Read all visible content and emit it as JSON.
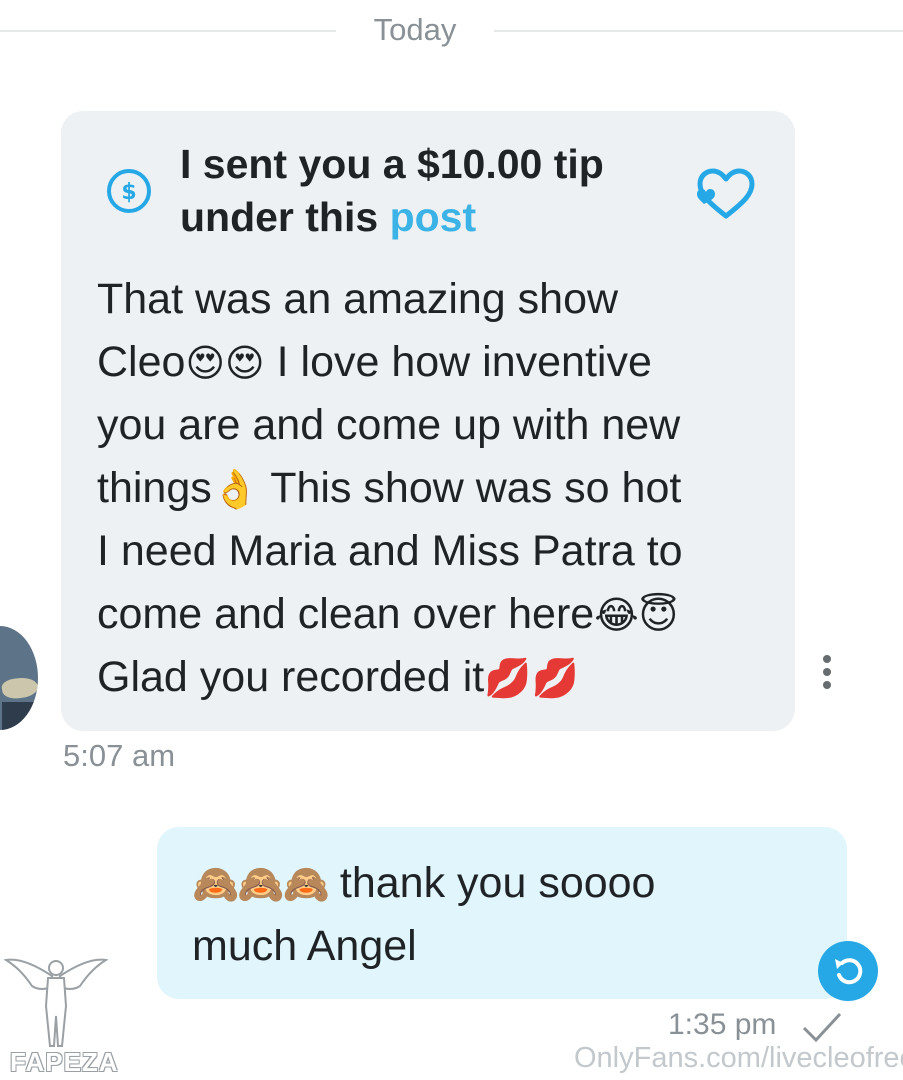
{
  "date_separator": "Today",
  "incoming": {
    "tip_line1": "I sent you a $10.00 tip",
    "tip_line2_prefix": "under this ",
    "tip_link": "post",
    "lines": [
      {
        "text": "That was an amazing show",
        "emoji": ""
      },
      {
        "text": "Cleo",
        "emoji": "😍😍",
        "after": " I love how inventive"
      },
      {
        "text": "you are and come up with new",
        "emoji": ""
      },
      {
        "text": "things",
        "emoji": "👌",
        "after": " This show was so hot"
      },
      {
        "text": "I need Maria and Miss Patra to",
        "emoji": ""
      },
      {
        "text": "come and clean over here",
        "emoji": "😂😇"
      },
      {
        "text": "Glad you recorded it",
        "emoji": "💋💋"
      }
    ],
    "time": "5:07 am"
  },
  "outgoing": {
    "emoji": "🙈🙈🙈",
    "line1": " thank you soooo",
    "line2": "much Angel",
    "time": "1:35 pm"
  },
  "watermark": "OnlyFans.com/livecleofree",
  "overlay_logo_text": "FAPEZA",
  "colors": {
    "accent": "#26a8e7",
    "link": "#3bb3e6",
    "incoming_bg": "#eef1f3",
    "outgoing_bg": "#e1f5fd"
  },
  "icons": {
    "tip": "dollar-circle-icon",
    "like": "heart-icon",
    "more": "more-vertical-icon",
    "undo": "undo-icon",
    "sent": "check-icon"
  }
}
